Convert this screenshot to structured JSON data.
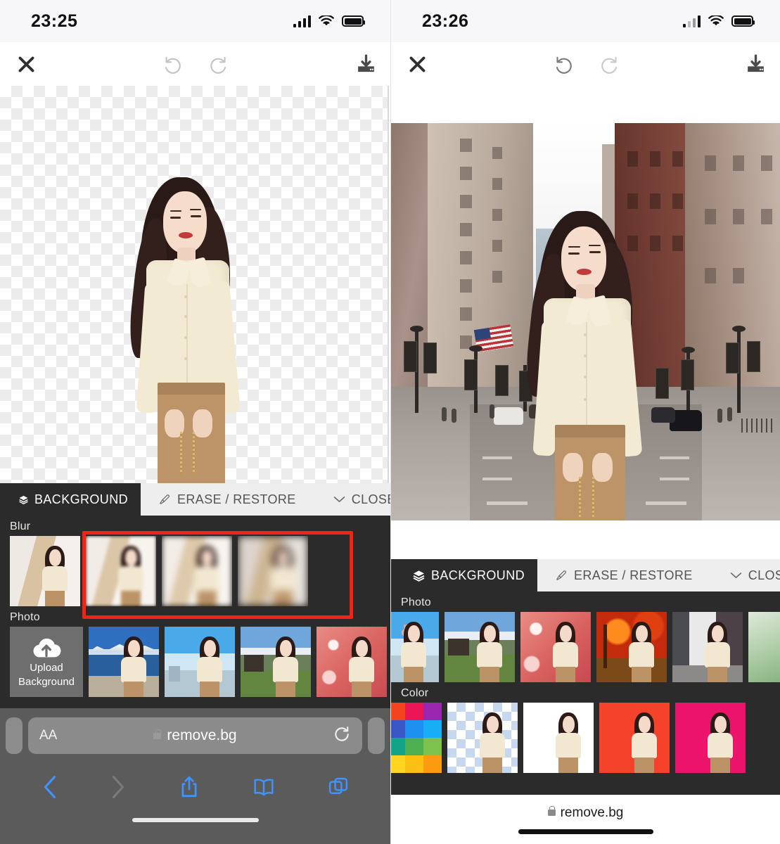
{
  "left_screen": {
    "status": {
      "time": "23:25",
      "signal": "signal-bars-full",
      "wifi": "wifi-icon",
      "battery": "battery-full"
    },
    "toolbar": {
      "close": "close-icon",
      "undo": "undo-icon",
      "redo": "redo-icon",
      "download": "download-icon"
    },
    "canvas": {
      "state": "transparent-background-checkerboard"
    },
    "tabs": [
      {
        "label": "BACKGROUND",
        "icon": "layers-icon",
        "active": true
      },
      {
        "label": "ERASE / RESTORE",
        "icon": "brush-icon",
        "active": false
      },
      {
        "label": "CLOSE",
        "icon": "chevron-down-icon",
        "active": false
      }
    ],
    "sections": [
      {
        "label": "Blur",
        "items": [
          {
            "name": "blur-original",
            "kind": "original",
            "selected": false
          },
          {
            "name": "blur-level-1",
            "kind": "blur",
            "blur": 3,
            "selected": false
          },
          {
            "name": "blur-level-2",
            "kind": "blur",
            "blur": 5,
            "selected": false
          },
          {
            "name": "blur-level-3",
            "kind": "blur",
            "blur": 8,
            "selected": false
          }
        ]
      },
      {
        "label": "Photo",
        "upload_label_line1": "Upload",
        "upload_label_line2": "Background",
        "upload_icon": "cloud-upload-icon",
        "items": [
          {
            "name": "photo-lake-mountains",
            "kind": "photo"
          },
          {
            "name": "photo-shanghai-skyline",
            "kind": "photo"
          },
          {
            "name": "photo-green-field-cabin",
            "kind": "photo"
          },
          {
            "name": "photo-pink-bokeh",
            "kind": "photo"
          }
        ]
      }
    ],
    "annotation": {
      "type": "red-rectangle-highlight",
      "color": "#f92114",
      "targets": "blur-level-1..3"
    },
    "browser": {
      "text_size_label": "AA",
      "url": "remove.bg",
      "lock": "lock-icon",
      "reload": "reload-icon",
      "back": "back-chevron-icon",
      "forward": "forward-chevron-icon",
      "share": "share-icon",
      "bookmarks": "book-icon",
      "tabs": "tabs-icon"
    }
  },
  "right_screen": {
    "status": {
      "time": "23:26",
      "signal": "signal-bars-weak",
      "wifi": "wifi-icon",
      "battery": "battery-full"
    },
    "toolbar": {
      "close": "close-icon",
      "undo": "undo-icon",
      "redo": "redo-icon",
      "download": "download-icon"
    },
    "canvas": {
      "state": "city-street-background-applied"
    },
    "tabs": [
      {
        "label": "BACKGROUND",
        "icon": "layers-icon",
        "active": true
      },
      {
        "label": "ERASE / RESTORE",
        "icon": "brush-icon",
        "active": false
      },
      {
        "label": "CLOSE",
        "icon": "chevron-down-icon",
        "active": false
      }
    ],
    "sections": [
      {
        "label": "Photo",
        "items": [
          {
            "name": "photo-shanghai-skyline",
            "kind": "photo"
          },
          {
            "name": "photo-green-field-cabin",
            "kind": "photo"
          },
          {
            "name": "photo-pink-bokeh",
            "kind": "photo"
          },
          {
            "name": "photo-autumn-leaves",
            "kind": "photo"
          },
          {
            "name": "photo-city-street",
            "kind": "photo",
            "selected": true
          },
          {
            "name": "photo-green-partial",
            "kind": "photo"
          }
        ]
      },
      {
        "label": "Color",
        "picker": {
          "name": "color-picker-swatch",
          "colors": [
            "#ffffff",
            "#f4441f",
            "#ec1656",
            "#9b27b0",
            "#6a35c9",
            "#3956c7",
            "#1e90f0",
            "#18aef5",
            "#0bbcd4",
            "#12a389",
            "#4caf50",
            "#7dc24b",
            "#cddc39",
            "#ffd521",
            "#fbc013",
            "#fb9b0d"
          ]
        },
        "items": [
          {
            "name": "color-transparent",
            "kind": "transparent"
          },
          {
            "name": "color-white",
            "kind": "solid",
            "color": "#ffffff"
          },
          {
            "name": "color-red",
            "kind": "solid",
            "color": "#f4432a"
          },
          {
            "name": "color-pink",
            "kind": "solid",
            "color": "#ec136a"
          }
        ]
      }
    ],
    "browser": {
      "url": "remove.bg",
      "lock": "lock-icon"
    }
  }
}
